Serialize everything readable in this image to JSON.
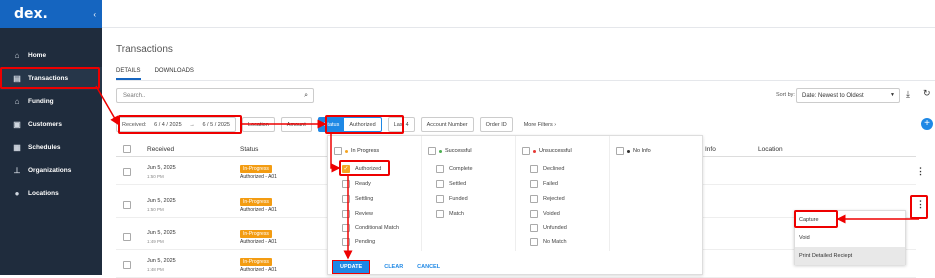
{
  "sidebar": {
    "logo": "dex.",
    "collapse_icon": "chevron-left-icon",
    "items": [
      {
        "label": "Home",
        "icon": "home-icon"
      },
      {
        "label": "Transactions",
        "icon": "receipt-icon",
        "active": true
      },
      {
        "label": "Funding",
        "icon": "bank-icon"
      },
      {
        "label": "Customers",
        "icon": "person-card-icon"
      },
      {
        "label": "Schedules",
        "icon": "calendar-icon"
      },
      {
        "label": "Organizations",
        "icon": "org-chart-icon"
      },
      {
        "label": "Locations",
        "icon": "pin-icon"
      }
    ]
  },
  "page": {
    "title": "Transactions"
  },
  "tabs": [
    {
      "label": "DETAILS"
    },
    {
      "label": "DOWNLOADS"
    }
  ],
  "search": {
    "placeholder": "Search.."
  },
  "sort": {
    "label": "Sort by:",
    "value": "Date: Newest to Oldest"
  },
  "filters": {
    "received_label": "Received:",
    "date_from": "6 / 4 / 2025",
    "arrow": "→",
    "date_to": "6 / 5 / 2025",
    "location": "Location",
    "amount": "Amount",
    "status": "Status",
    "status_value": "Authorized",
    "last4": "Last 4",
    "account_number": "Account Number",
    "order_id": "Order ID",
    "more_filters": "More Filters",
    "more_caret": "›",
    "add": "+"
  },
  "table": {
    "headers": [
      "Received",
      "Status",
      "Info",
      "Location"
    ],
    "rows": [
      {
        "date": "Jun 5, 2025",
        "time": "1:50 PM",
        "status": "In-Progress",
        "sub": "Authorized - A01"
      },
      {
        "date": "Jun 5, 2025",
        "time": "1:50 PM",
        "status": "In-Progress",
        "sub": "Authorized - A01"
      },
      {
        "date": "Jun 5, 2025",
        "time": "1:49 PM",
        "status": "In-Progress",
        "sub": "Authorized - A01"
      },
      {
        "date": "Jun 5, 2025",
        "time": "1:48 PM",
        "status": "In-Progress",
        "sub": "Authorized - A01"
      }
    ]
  },
  "status_dropdown": {
    "groups": [
      {
        "label": "In Progress",
        "color": "#f5a623",
        "options": [
          "Authorized",
          "Ready",
          "Settling",
          "Review",
          "Conditional Match",
          "Pending"
        ],
        "checked": [
          "Authorized"
        ]
      },
      {
        "label": "Successful",
        "color": "#4caf50",
        "options": [
          "Complete",
          "Settled",
          "Funded",
          "Match"
        ],
        "checked": []
      },
      {
        "label": "Unsuccessful",
        "color": "#e53935",
        "options": [
          "Declined",
          "Failed",
          "Rejected",
          "Voided",
          "Unfunded",
          "No Match"
        ],
        "checked": []
      },
      {
        "label": "No Info",
        "color": "#333333",
        "options": [],
        "checked": []
      }
    ],
    "update": "UPDATE",
    "clear": "CLEAR",
    "cancel": "CANCEL"
  },
  "row_menu": {
    "items": [
      "Capture",
      "Void",
      "Print Detailed Reciept"
    ]
  },
  "colors": {
    "sidebar": "#1f2c3d",
    "brand": "#1565c0",
    "accent": "#1e88e5",
    "badge": "#f39c12",
    "highlight": "#e00000"
  }
}
